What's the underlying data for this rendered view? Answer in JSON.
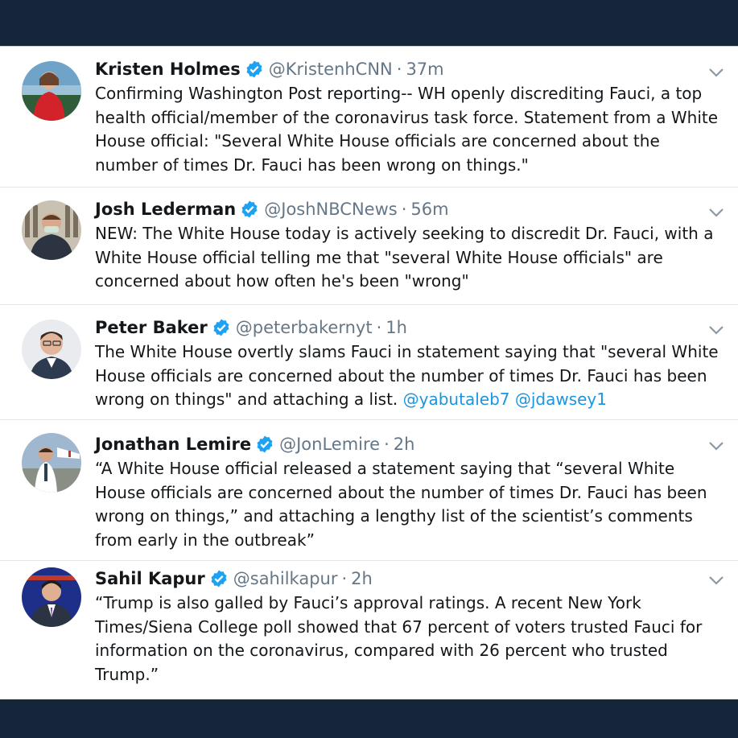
{
  "colors": {
    "frame": "#15253a",
    "verified": "#1da1f2",
    "link": "#1b95e0",
    "secondary": "#657786"
  },
  "tweets": [
    {
      "name": "Kristen Holmes",
      "handle": "@KristenhCNN",
      "time": "37m",
      "lines": [
        "Confirming Washington Post reporting-- WH openly discrediting Fauci, a top",
        "health official/member of the coronavirus task force. Statement from a White",
        "House official:  \"Several White House officials are concerned about the",
        "number of times Dr. Fauci has been wrong on things.\""
      ]
    },
    {
      "name": "Josh Lederman",
      "handle": "@JoshNBCNews",
      "time": "56m",
      "lines": [
        "NEW: The White House today is actively seeking to discredit Dr. Fauci, with a",
        "White House official telling me that \"several White House officials\" are",
        "concerned about how often he's been \"wrong\""
      ]
    },
    {
      "name": "Peter Baker",
      "handle": "@peterbakernyt",
      "time": "1h",
      "lines": [
        "The White House overtly slams Fauci in statement saying that \"several White",
        "House officials are concerned about the number of times Dr. Fauci has been",
        "wrong on things\" and attaching a list. "
      ],
      "mentions": [
        "@yabutaleb7",
        "@jdawsey1"
      ]
    },
    {
      "name": "Jonathan Lemire",
      "handle": "@JonLemire",
      "time": "2h",
      "lines": [
        "“A White House official released a statement saying that “several White",
        "House officials are concerned about the number of times Dr. Fauci has been",
        "wrong on things,” and attaching a lengthy list of the scientist’s comments",
        "from early in the outbreak”"
      ]
    },
    {
      "name": "Sahil Kapur",
      "handle": "@sahilkapur",
      "time": "2h",
      "lines": [
        "“Trump is also galled by Fauci’s approval ratings. A recent New York",
        "Times/Siena College poll showed that 67 percent of voters trusted Fauci for",
        "information on the coronavirus, compared with 26 percent who trusted",
        "Trump.”"
      ]
    }
  ],
  "dot": "·"
}
